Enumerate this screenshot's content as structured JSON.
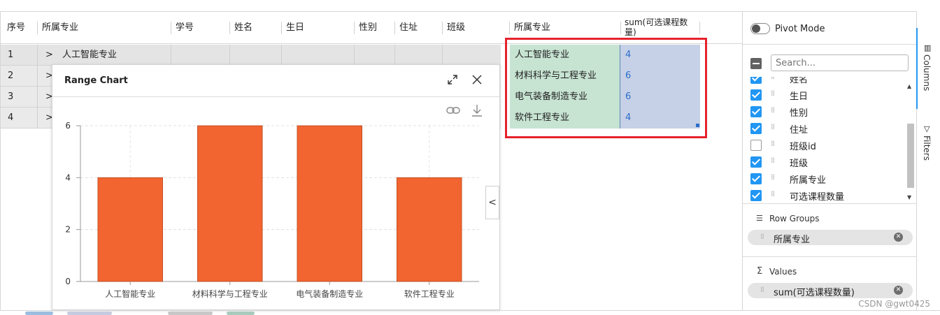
{
  "grid": {
    "columns": [
      "序号",
      "所属专业",
      "学号",
      "姓名",
      "生日",
      "性别",
      "住址",
      "班级"
    ],
    "rows": [
      {
        "num": "1",
        "group": "人工智能专业"
      },
      {
        "num": "2",
        "group": ""
      },
      {
        "num": "3",
        "group": ""
      },
      {
        "num": "4",
        "group": ""
      }
    ],
    "expand_glyph": ">"
  },
  "pivot_table": {
    "col1": "所属专业",
    "col2": "sum(可选课程数量)",
    "rows": [
      {
        "major": "人工智能专业",
        "value": "4"
      },
      {
        "major": "材料科学与工程专业",
        "value": "6"
      },
      {
        "major": "电气装备制造专业",
        "value": "6"
      },
      {
        "major": "软件工程专业",
        "value": "4"
      }
    ]
  },
  "chart_window": {
    "title": "Range Chart",
    "expand_icon": "expand-icon",
    "close_icon": "close-icon",
    "link_icon": "link-icon",
    "download_icon": "download-icon",
    "collapse_glyph": "<"
  },
  "chart_data": {
    "type": "bar",
    "categories": [
      "人工智能专业",
      "材料科学与工程专业",
      "电气装备制造专业",
      "软件工程专业"
    ],
    "values": [
      4,
      6,
      6,
      4
    ],
    "yticks": [
      "0",
      "2",
      "4",
      "6"
    ],
    "ylim": [
      0,
      6
    ],
    "grid": true,
    "bar_color": "#f26430"
  },
  "side_panel": {
    "pivot_mode_label": "Pivot Mode",
    "search_placeholder": "Search...",
    "columns": [
      {
        "label": "姓名",
        "checked": true
      },
      {
        "label": "生日",
        "checked": true
      },
      {
        "label": "性别",
        "checked": true
      },
      {
        "label": "住址",
        "checked": true
      },
      {
        "label": "班级id",
        "checked": false
      },
      {
        "label": "班级",
        "checked": true
      },
      {
        "label": "所属专业",
        "checked": true
      },
      {
        "label": "可选课程数量",
        "checked": true
      }
    ],
    "row_groups_title": "Row Groups",
    "row_group_item": "所属专业",
    "values_title": "Values",
    "values_item": "sum(可选课程数量)"
  },
  "side_tabs": {
    "columns": "Columns",
    "filters": "Filters"
  },
  "watermark": "CSDN @gwt0425",
  "colors": {
    "accent": "#2196f3",
    "bar": "#f26430",
    "highlight_border": "#e5232d"
  }
}
